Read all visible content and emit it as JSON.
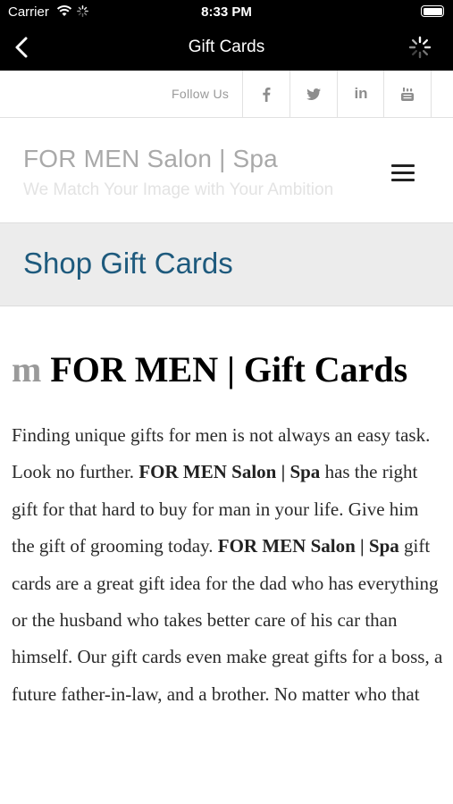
{
  "status_bar": {
    "carrier": "Carrier",
    "time": "8:33 PM"
  },
  "nav": {
    "title": "Gift Cards"
  },
  "social": {
    "follow_label": "Follow Us",
    "icons": [
      "facebook-icon",
      "twitter-icon",
      "linkedin-icon",
      "youtube-icon"
    ]
  },
  "header": {
    "brand": "FOR MEN Salon | Spa",
    "tagline": "We Match Your Image with Your Ambition"
  },
  "banner": {
    "title": "Shop Gift Cards"
  },
  "article": {
    "title_prefix": "m",
    "title": "FOR MEN | Gift Cards",
    "p1": "Finding unique gifts for men is not always an easy task. Look no further.",
    "b1": "FOR MEN Salon | Spa",
    "p2": "has the right gift for that hard to buy for man in your life. Give him the gift of grooming today.",
    "b2": "FOR MEN Salon | Spa",
    "p3": "gift cards are a great gift idea for the dad who has everything or the husband who takes better care of his car than himself. Our gift cards even make great gifts for a boss, a future father-in-law, and a brother. No matter who that"
  },
  "colors": {
    "bar": "#000000",
    "accent": "#1e5a7d",
    "brand_gray": "#a9a9a9"
  }
}
